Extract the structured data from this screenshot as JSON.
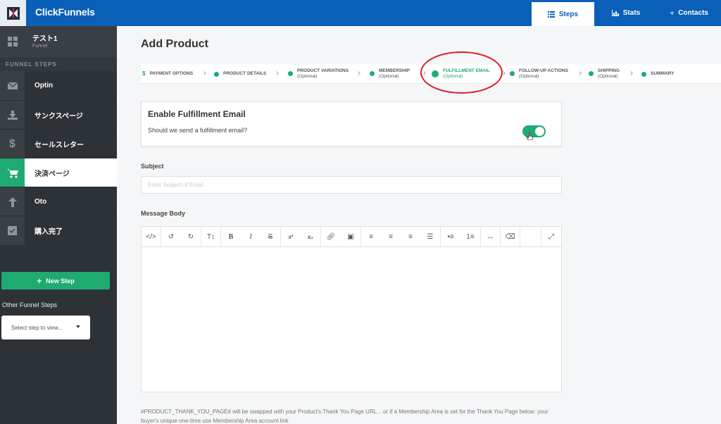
{
  "app": {
    "brand": "ClickFunnels",
    "nav": [
      {
        "label": "Steps",
        "icon": "list-icon",
        "active": true
      },
      {
        "label": "Stats",
        "icon": "bar-chart-icon",
        "active": false
      },
      {
        "label": "Contacts",
        "icon": "users-icon",
        "active": false
      }
    ]
  },
  "sidebar": {
    "funnel_title": "テスト1",
    "funnel_subtitle": "Funnel",
    "section_label": "FUNNEL STEPS",
    "steps": [
      {
        "label": "Optin",
        "icon": "envelope-icon",
        "active": false
      },
      {
        "label": "サンクスページ",
        "icon": "download-icon",
        "active": false
      },
      {
        "label": "セールスレター",
        "icon": "dollar-icon",
        "active": false
      },
      {
        "label": "決済ページ",
        "icon": "cart-icon",
        "active": true
      },
      {
        "label": "Oto",
        "icon": "arrow-up-icon",
        "active": false
      },
      {
        "label": "購入完了",
        "icon": "checkbox-icon",
        "active": false
      }
    ],
    "new_step_label": "New Step",
    "other_steps_label": "Other Funnel Steps",
    "select_placeholder": "Select step to view..."
  },
  "main": {
    "title": "Add Product",
    "wizard": [
      {
        "label": "PAYMENT OPTIONS",
        "optional": ""
      },
      {
        "label": "PRODUCT DETAILS",
        "optional": ""
      },
      {
        "label": "PRODUCT VARIATIONS",
        "optional": "(Optional)"
      },
      {
        "label": "MEMBERSHIP",
        "optional": "(Optional)"
      },
      {
        "label": "FULFILLMENT EMAIL",
        "optional": "(Optional)"
      },
      {
        "label": "FOLLOW-UP ACTIONS",
        "optional": "(Optional)"
      },
      {
        "label": "SHIPPING",
        "optional": "(Optional)"
      },
      {
        "label": "SUMMARY",
        "optional": ""
      }
    ],
    "fulfillment_card": {
      "title": "Enable Fulfillment Email",
      "question": "Should we send a fulfillment email?",
      "enabled": true
    },
    "subject_label": "Subject",
    "subject_placeholder": "Enter Subject of Email",
    "message_label": "Message Body",
    "footer_note": "#PRODUCT_THANK_YOU_PAGE# will be swapped with your Product's Thank You Page URL... or if a Membership Area is set for the Thank You Page below: your buyer's unique one-time use Membership Area account link"
  },
  "colors": {
    "topbar": "#0a5fb8",
    "sidebar": "#2d3237",
    "accent_green": "#1faa71",
    "annotation_red": "#d6202a"
  }
}
